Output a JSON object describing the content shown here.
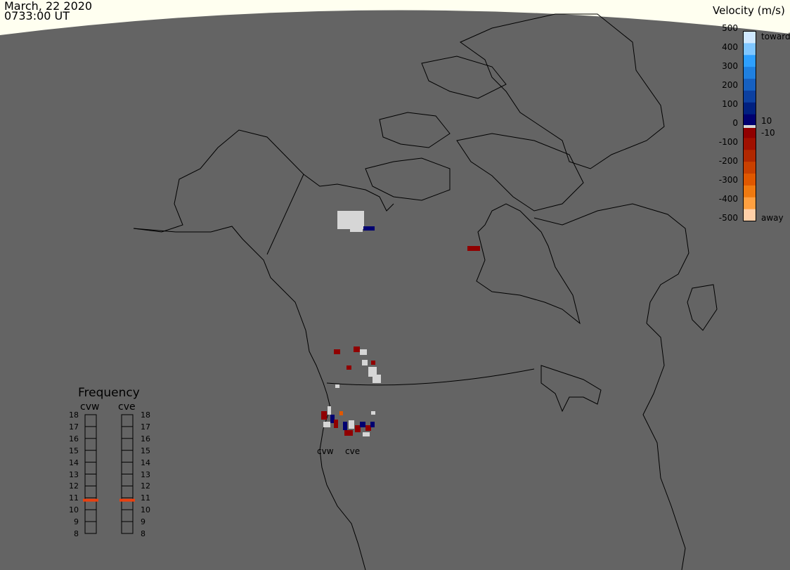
{
  "timestamp": {
    "date": "March, 22 2020",
    "time": "0733:00 UT"
  },
  "velocity_scale": {
    "title": "Velocity (m/s)",
    "ticks": [
      "500",
      "400",
      "300",
      "200",
      "100",
      "0",
      "-100",
      "-200",
      "-300",
      "-400",
      "-500"
    ],
    "near_zero_ticks": [
      "10",
      "-10"
    ],
    "toward_label": "toward",
    "away_label": "away",
    "colors": [
      "#cfe8ff",
      "#7fc6ff",
      "#2ea0ff",
      "#1f80e0",
      "#1660c0",
      "#0c40a0",
      "#002080",
      "#000070",
      "#900000",
      "#a01000",
      "#b02800",
      "#c84000",
      "#e05800",
      "#f07a10",
      "#ffa040",
      "#ffd0a8"
    ],
    "ground_scatter_color": "#d6d6d6"
  },
  "frequency": {
    "title": "Frequency",
    "radars": [
      {
        "name": "cvw",
        "value_mhz": 10.8
      },
      {
        "name": "cve",
        "value_mhz": 10.8
      }
    ],
    "scale": [
      "18",
      "17",
      "16",
      "15",
      "14",
      "13",
      "12",
      "11",
      "10",
      "9",
      "8"
    ],
    "marker_color": "#e84010"
  },
  "map": {
    "sea_color": "#646464",
    "coast_color": "#000000",
    "sunlit_color": "#fffff0",
    "site_labels": [
      "cvw",
      "cve"
    ]
  }
}
